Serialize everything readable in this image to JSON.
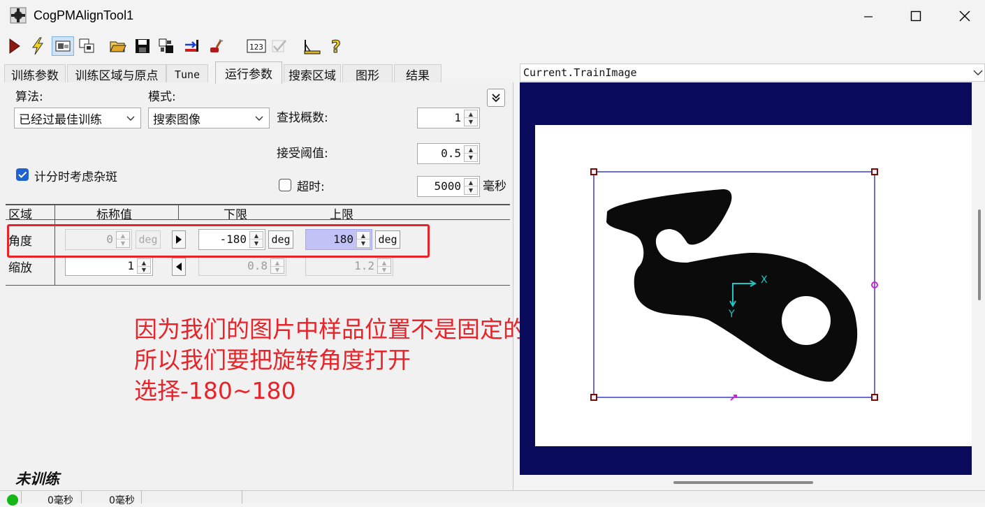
{
  "window": {
    "title": "CogPMAlignTool1",
    "controls": [
      "minimize",
      "maximize",
      "close"
    ]
  },
  "toolbar": {
    "icons": [
      "run-icon",
      "lightning-icon",
      "train-icon",
      "copy-image-icon",
      "open-folder-icon",
      "save-icon",
      "input-output-icon",
      "reset-icon",
      "electric-icon",
      "numeric-display-icon",
      "checkmark-disabled-icon",
      "ruler-icon",
      "help-icon"
    ]
  },
  "tabs": [
    {
      "label": "训练参数",
      "active": false
    },
    {
      "label": "训练区域与原点",
      "active": false
    },
    {
      "label": "Tune",
      "active": false
    },
    {
      "label": "运行参数",
      "active": true
    },
    {
      "label": "搜索区域",
      "active": false
    },
    {
      "label": "图形",
      "active": false
    },
    {
      "label": "结果",
      "active": false
    }
  ],
  "run_params": {
    "algorithm_label": "算法:",
    "algorithm_value": "已经过最佳训练",
    "mode_label": "模式:",
    "mode_value": "搜索图像",
    "find_count_label": "查找概数:",
    "find_count_value": "1",
    "accept_threshold_label": "接受阈值:",
    "accept_threshold_value": "0.5",
    "clutter_label": "计分时考虑杂斑",
    "clutter_checked": true,
    "timeout_label": "超时:",
    "timeout_checked": false,
    "timeout_value": "5000",
    "timeout_unit": "毫秒"
  },
  "zone_table": {
    "headers": [
      "区域",
      "标称值",
      "下限",
      "上限"
    ],
    "rows": [
      {
        "name": "角度",
        "nominal": "0",
        "nominal_unit": "deg",
        "low": "-180",
        "low_unit": "deg",
        "high": "180",
        "high_unit": "deg"
      },
      {
        "name": "缩放",
        "nominal": "1",
        "low": "0.8",
        "high": "1.2"
      }
    ]
  },
  "annotation": {
    "line1": "因为我们的图片中样品位置不是固定的",
    "line2": "所以我们要把旋转角度打开",
    "line3": "选择-180~180",
    "color": "#e8242b"
  },
  "status": {
    "train_state": "未训练",
    "time1": "0毫秒",
    "time2": "0毫秒"
  },
  "image_view": {
    "selector": "Current.TrainImage",
    "marker_x": "X",
    "marker_y": "Y"
  }
}
